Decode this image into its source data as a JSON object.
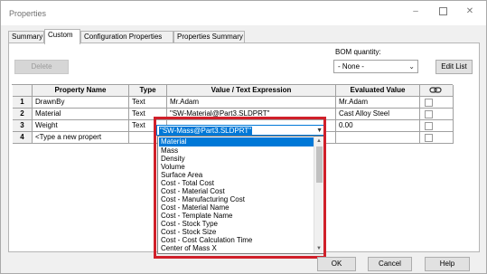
{
  "window": {
    "title": "Properties"
  },
  "tabs": [
    {
      "label": "Summary"
    },
    {
      "label": "Custom"
    },
    {
      "label": "Configuration Properties"
    },
    {
      "label": "Properties Summary"
    }
  ],
  "toolbar": {
    "delete_label": "Delete",
    "edit_list_label": "Edit List"
  },
  "bom": {
    "label": "BOM quantity:",
    "value": "- None -"
  },
  "grid": {
    "headers": {
      "name": "Property Name",
      "type": "Type",
      "value": "Value / Text Expression",
      "evaluated": "Evaluated Value"
    },
    "rows": [
      {
        "num": "1",
        "name": "DrawnBy",
        "type": "Text",
        "value": "Mr.Adam",
        "evaluated": "Mr.Adam"
      },
      {
        "num": "2",
        "name": "Material",
        "type": "Text",
        "value": "\"SW-Material@Part3.SLDPRT\"",
        "evaluated": "Cast Alloy Steel"
      },
      {
        "num": "3",
        "name": "Weight",
        "type": "Text",
        "value": "\"SW-Mass@Part3.SLDPRT\"",
        "evaluated": "0.00"
      },
      {
        "num": "4",
        "name": "<Type a new propert",
        "type": "",
        "value": "",
        "evaluated": ""
      }
    ]
  },
  "dropdown": {
    "items": [
      "Material",
      "Mass",
      "Density",
      "Volume",
      "Surface Area",
      "Cost - Total Cost",
      "Cost - Material Cost",
      "Cost - Manufacturing Cost",
      "Cost - Material Name",
      "Cost - Template Name",
      "Cost - Stock Type",
      "Cost - Stock Size",
      "Cost - Cost Calculation Time",
      "Center of Mass X"
    ],
    "selected": "Material"
  },
  "footer": {
    "ok": "OK",
    "cancel": "Cancel",
    "help": "Help"
  },
  "colors": {
    "accent": "#0078d7",
    "highlight": "#d0202a"
  }
}
